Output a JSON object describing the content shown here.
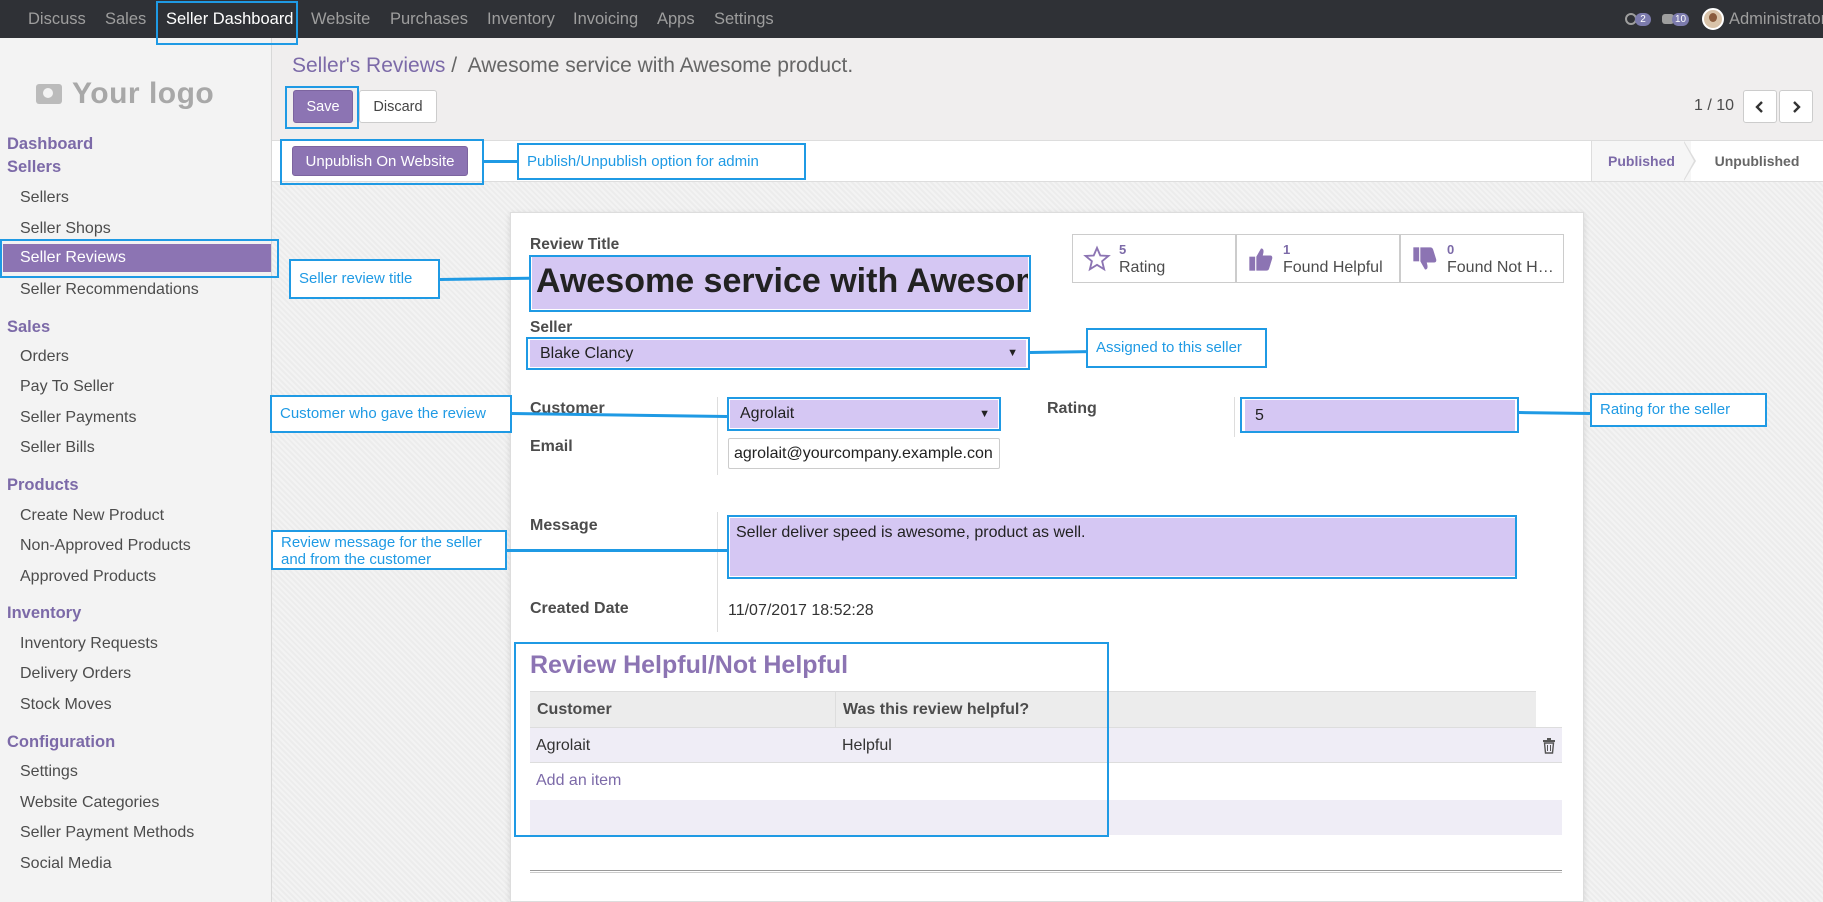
{
  "topnav": {
    "items": [
      "Discuss",
      "Sales",
      "Seller Dashboard",
      "Website",
      "Purchases",
      "Inventory",
      "Invoicing",
      "Apps",
      "Settings"
    ],
    "active": "Seller Dashboard",
    "activity_count": "2",
    "messages_count": "10",
    "user": "Administrator"
  },
  "sidebar": {
    "logo_text": "Your logo",
    "dashboard": "Dashboard",
    "sellers_section": "Sellers",
    "sellers_items": [
      "Sellers",
      "Seller Shops",
      "Seller Reviews",
      "Seller Recommendations"
    ],
    "sales_section": "Sales",
    "sales_items": [
      "Orders",
      "Pay To Seller",
      "Seller Payments",
      "Seller Bills"
    ],
    "products_section": "Products",
    "products_items": [
      "Create New Product",
      "Non-Approved Products",
      "Approved Products"
    ],
    "inventory_section": "Inventory",
    "inventory_items": [
      "Inventory Requests",
      "Delivery Orders",
      "Stock Moves"
    ],
    "configuration_section": "Configuration",
    "configuration_items": [
      "Settings",
      "Website Categories",
      "Seller Payment Methods",
      "Social Media"
    ],
    "active_item": "Seller Reviews"
  },
  "breadcrumb": {
    "parent": "Seller's Reviews",
    "separator": "/",
    "current": "Awesome service with Awesome product."
  },
  "control": {
    "save_label": "Save",
    "discard_label": "Discard",
    "pager": "1 / 10"
  },
  "statusbar": {
    "unpublish_label": "Unpublish On Website",
    "stages": [
      "Published",
      "Unpublished"
    ],
    "active_stage": "Published"
  },
  "stats": [
    {
      "value": "5",
      "label": "Rating",
      "icon": "star-icon"
    },
    {
      "value": "1",
      "label": "Found Helpful",
      "icon": "thumbs-up-icon"
    },
    {
      "value": "0",
      "label": "Found Not H…",
      "icon": "thumbs-down-icon"
    }
  ],
  "form": {
    "review_title_label": "Review Title",
    "review_title": "Awesome service with Awesom",
    "seller_label": "Seller",
    "seller": "Blake Clancy",
    "customer_label": "Customer",
    "customer": "Agrolait",
    "email_label": "Email",
    "email": "agrolait@yourcompany.example.con",
    "rating_label": "Rating",
    "rating": "5",
    "message_label": "Message",
    "message": "Seller deliver speed is awesome, product as well.",
    "created_label": "Created Date",
    "created": "11/07/2017 18:52:28"
  },
  "helpful_section": {
    "title": "Review Helpful/Not Helpful",
    "columns": [
      "Customer",
      "Was this review helpful?"
    ],
    "rows": [
      {
        "customer": "Agrolait",
        "helpful": "Helpful"
      }
    ],
    "add_item": "Add an item"
  },
  "annotations": {
    "publish": "Publish/Unpublish option for admin",
    "title": "Seller review title",
    "seller": "Assigned to this seller",
    "customer": "Customer who gave the review",
    "rating": "Rating for the seller",
    "message_line1": "Review message for the seller",
    "message_line2": "and from the customer"
  },
  "colors": {
    "accent": "#8c74b3",
    "topbar": "#2f3136",
    "highlight_field": "#d5c7f3",
    "annotation": "#1f9ae4"
  }
}
